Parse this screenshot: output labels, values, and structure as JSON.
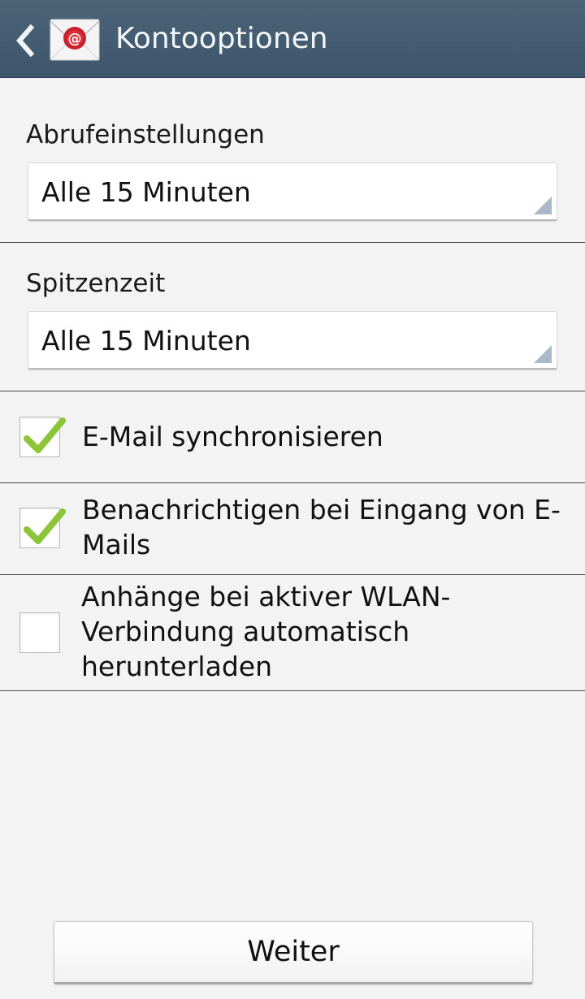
{
  "header": {
    "title": "Kontooptionen",
    "back_icon": "chevron-left",
    "app_icon": "email-envelope-at",
    "background_color": "#455d72"
  },
  "sync_settings": {
    "retrieval": {
      "label": "Abrufeinstellungen",
      "value": "Alle 15 Minuten"
    },
    "peak_time": {
      "label": "Spitzenzeit",
      "value": "Alle 15 Minuten"
    }
  },
  "options": [
    {
      "label": "E-Mail synchronisieren",
      "checked": true
    },
    {
      "label": "Benachrichtigen bei Eingang von E-Mails",
      "checked": true
    },
    {
      "label": "Anhänge bei aktiver WLAN-Verbindung automatisch herunterladen",
      "checked": false
    }
  ],
  "footer": {
    "next_label": "Weiter"
  },
  "colors": {
    "check_mark": "#8cc43a",
    "background": "#f3f3f3",
    "spinner_arrow": "#a9b9c7"
  }
}
